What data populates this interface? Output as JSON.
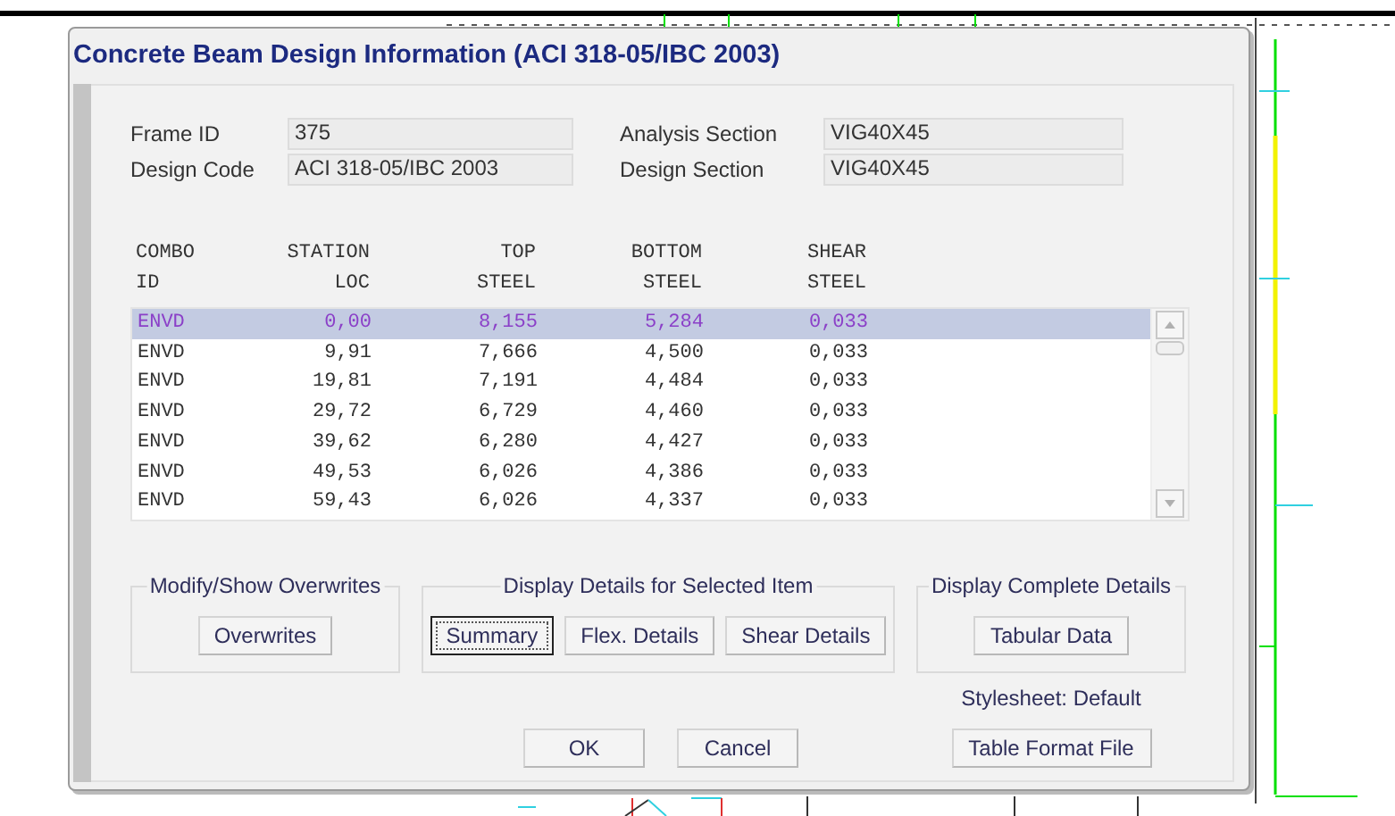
{
  "window": {
    "title": "Concrete Beam Design Information (ACI 318-05/IBC 2003)"
  },
  "fields": [
    {
      "label": "Frame ID",
      "value": "375"
    },
    {
      "label": "Design Code",
      "value": "ACI 318-05/IBC 2003"
    },
    {
      "label": "Analysis Section",
      "value": "VIG40X45"
    },
    {
      "label": "Design Section",
      "value": "VIG40X45"
    }
  ],
  "table": {
    "columns": [
      {
        "line1": "COMBO",
        "line2": "ID"
      },
      {
        "line1": "STATION",
        "line2": "LOC"
      },
      {
        "line1": "TOP",
        "line2": "STEEL"
      },
      {
        "line1": "BOTTOM",
        "line2": "STEEL"
      },
      {
        "line1": "SHEAR",
        "line2": "STEEL"
      }
    ],
    "rows": [
      {
        "cells": [
          "ENVD",
          "0,00",
          "8,155",
          "5,284",
          "0,033"
        ],
        "selected": true
      },
      {
        "cells": [
          "ENVD",
          "9,91",
          "7,666",
          "4,500",
          "0,033"
        ],
        "selected": false
      },
      {
        "cells": [
          "ENVD",
          "19,81",
          "7,191",
          "4,484",
          "0,033"
        ],
        "selected": false
      },
      {
        "cells": [
          "ENVD",
          "29,72",
          "6,729",
          "4,460",
          "0,033"
        ],
        "selected": false
      },
      {
        "cells": [
          "ENVD",
          "39,62",
          "6,280",
          "4,427",
          "0,033"
        ],
        "selected": false
      },
      {
        "cells": [
          "ENVD",
          "49,53",
          "6,026",
          "4,386",
          "0,033"
        ],
        "selected": false
      },
      {
        "cells": [
          "ENVD",
          "59,43",
          "6,026",
          "4,337",
          "0,033"
        ],
        "selected": false
      }
    ]
  },
  "groups": [
    {
      "title": "Modify/Show Overwrites",
      "buttons": [
        {
          "label": "Overwrites",
          "focused": false
        }
      ]
    },
    {
      "title": "Display Details for Selected Item",
      "buttons": [
        {
          "label": "Summary",
          "focused": true
        },
        {
          "label": "Flex. Details",
          "focused": false
        },
        {
          "label": "Shear Details",
          "focused": false
        }
      ]
    },
    {
      "title": "Display Complete Details",
      "buttons": [
        {
          "label": "Tabular Data",
          "focused": false
        }
      ]
    }
  ],
  "stylesheet": "Stylesheet: Default",
  "dialog_buttons": [
    {
      "label": "OK"
    },
    {
      "label": "Cancel"
    }
  ],
  "table_format_button": {
    "label": "Table Format File"
  }
}
